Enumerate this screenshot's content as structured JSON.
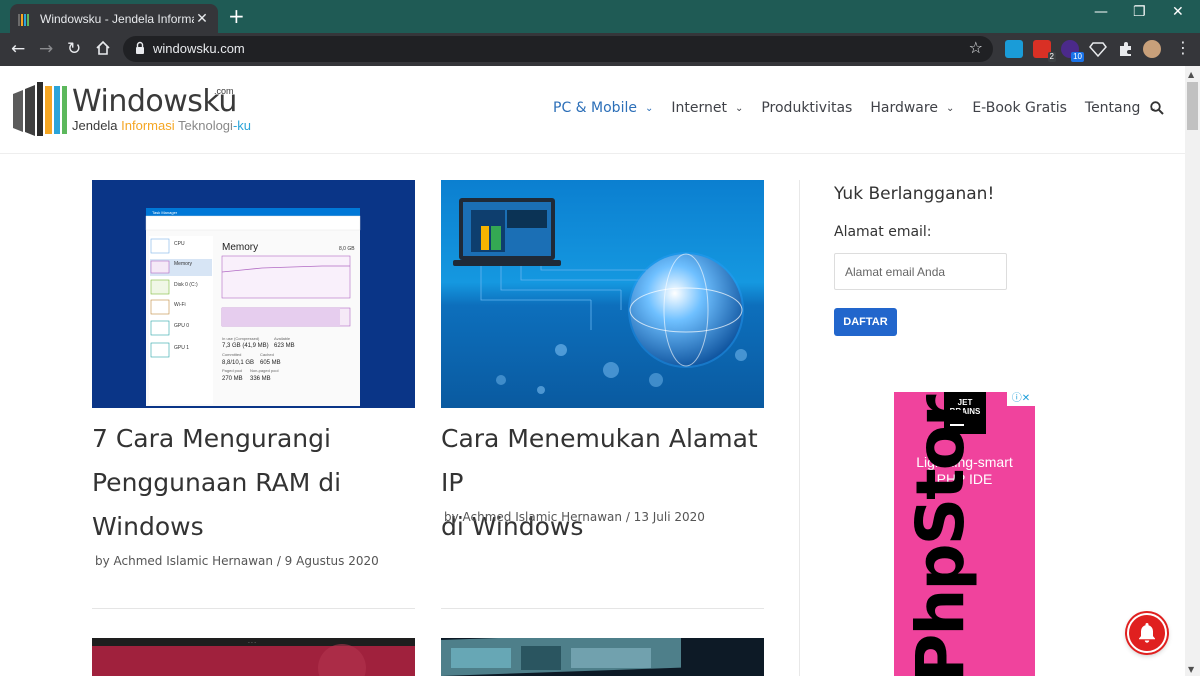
{
  "browser": {
    "tab_title": "Windowsku - Jendela Informasi T",
    "tab_close": "✕",
    "new_tab": "+",
    "url": "windowsku.com",
    "window_controls": {
      "minimize": "—",
      "restore": "❐",
      "close": "✕"
    },
    "extensions": [
      {
        "name": "translate-extension-icon",
        "badge": ""
      },
      {
        "name": "calendar-extension-icon",
        "badge": "2"
      },
      {
        "name": "purple-extension-icon",
        "badge": "10"
      },
      {
        "name": "diamond-extension-icon",
        "badge": ""
      },
      {
        "name": "extensions-puzzle-icon",
        "badge": ""
      }
    ]
  },
  "site": {
    "logo_text": "Windowsku",
    "logo_com": ".com",
    "tagline": {
      "w1": "Jendela ",
      "w2": "Informasi ",
      "w3": "Teknologi",
      "w4": "-ku"
    },
    "nav": [
      {
        "label": "PC & Mobile",
        "has_caret": true,
        "active": true
      },
      {
        "label": "Internet",
        "has_caret": true,
        "active": false
      },
      {
        "label": "Produktivitas",
        "has_caret": false,
        "active": false
      },
      {
        "label": "Hardware",
        "has_caret": true,
        "active": false
      },
      {
        "label": "E-Book Gratis",
        "has_caret": false,
        "active": false
      },
      {
        "label": "Tentang",
        "has_caret": true,
        "active": false
      }
    ],
    "nav_caret": "⌄"
  },
  "posts": [
    {
      "title_lines": [
        "7 Cara Mengurangi",
        "Penggunaan RAM di",
        "Windows"
      ],
      "meta": "by Achmed Islamic Hernawan / 9 Agustus 2020",
      "image": {
        "window_title": "Task Manager",
        "heading": "Memory",
        "total": "8,0 GB",
        "in_use_label": "In use (Compressed)",
        "in_use": "7,3 GB (41,9 MB)",
        "available_label": "Available",
        "available": "623 MB",
        "committed_label": "Committed",
        "committed": "8,8/10,1 GB",
        "cached_label": "Cached",
        "cached": "605 MB",
        "paged_label": "Paged pool",
        "paged": "270 MB",
        "nonpaged_label": "Non-paged pool",
        "nonpaged": "336 MB",
        "sidebar": [
          "CPU",
          "Memory",
          "Disk 0 (C:)",
          "Wi-Fi",
          "GPU 0",
          "GPU 1"
        ]
      }
    },
    {
      "title_lines": [
        "Cara Menemukan Alamat IP",
        "di Windows"
      ],
      "meta": "by Achmed Islamic Hernawan / 13 Juli 2020"
    }
  ],
  "sidebar": {
    "widget_title": "Yuk Berlangganan!",
    "email_label": "Alamat email:",
    "email_placeholder": "Alamat email Anda",
    "email_value": "",
    "subscribe_label": "DAFTAR"
  },
  "ad": {
    "jb_logo_line1": "JET",
    "jb_logo_line2": "BRAINS",
    "adchoices": "ⓘ✕",
    "tagline": "Lightning-smart PHP IDE",
    "brand": "PhpStorm"
  },
  "colors": {
    "tab_bar": "#1f5b55",
    "accent": "#2c6fb8",
    "button": "#2266cc",
    "ad_bg": "#f0439d",
    "notif": "#e0201f"
  }
}
